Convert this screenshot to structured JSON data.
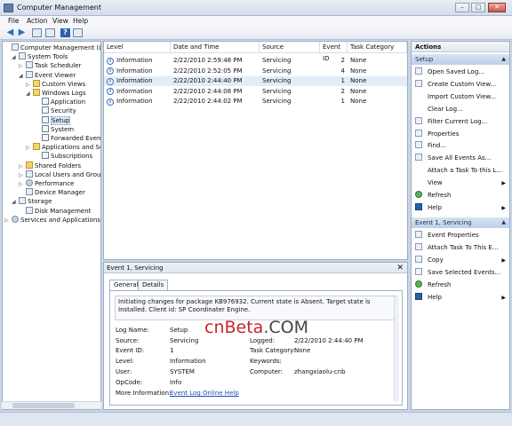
{
  "window": {
    "title": "Computer Management"
  },
  "menu": [
    "File",
    "Action",
    "View",
    "Help"
  ],
  "tree": [
    {
      "label": "Computer Management (Local",
      "icon": "computer-icon",
      "exp": ""
    },
    {
      "label": "System Tools",
      "icon": "tools-icon",
      "exp": "◢"
    },
    {
      "label": "Task Scheduler",
      "icon": "scheduler-icon",
      "exp": "▷"
    },
    {
      "label": "Event Viewer",
      "icon": "event-viewer-icon",
      "exp": "◢"
    },
    {
      "label": "Custom Views",
      "icon": "folder-icon",
      "exp": "▷"
    },
    {
      "label": "Windows Logs",
      "icon": "folder-icon",
      "exp": "◢"
    },
    {
      "label": "Application",
      "icon": "log-icon",
      "exp": ""
    },
    {
      "label": "Security",
      "icon": "log-icon",
      "exp": ""
    },
    {
      "label": "Setup",
      "icon": "log-icon",
      "exp": ""
    },
    {
      "label": "System",
      "icon": "log-icon",
      "exp": ""
    },
    {
      "label": "Forwarded Event",
      "icon": "log-icon",
      "exp": ""
    },
    {
      "label": "Applications and Se",
      "icon": "folder-icon",
      "exp": "▷"
    },
    {
      "label": "Subscriptions",
      "icon": "log-icon",
      "exp": ""
    },
    {
      "label": "Shared Folders",
      "icon": "folder-icon",
      "exp": "▷"
    },
    {
      "label": "Local Users and Groups",
      "icon": "users-icon",
      "exp": "▷"
    },
    {
      "label": "Performance",
      "icon": "performance-icon",
      "exp": "▷"
    },
    {
      "label": "Device Manager",
      "icon": "device-manager-icon",
      "exp": ""
    },
    {
      "label": "Storage",
      "icon": "storage-icon",
      "exp": "◢"
    },
    {
      "label": "Disk Management",
      "icon": "disk-icon",
      "exp": ""
    },
    {
      "label": "Services and Applications",
      "icon": "services-icon",
      "exp": "▷"
    }
  ],
  "events": {
    "columns": [
      "Level",
      "Date and Time",
      "Source",
      "Event ID",
      "Task Category"
    ],
    "rows": [
      {
        "level": "Information",
        "date": "2/22/2010 2:59:48 PM",
        "source": "Servicing",
        "id": "2",
        "category": "None"
      },
      {
        "level": "Information",
        "date": "2/22/2010 2:52:05 PM",
        "source": "Servicing",
        "id": "4",
        "category": "None"
      },
      {
        "level": "Information",
        "date": "2/22/2010 2:44:40 PM",
        "source": "Servicing",
        "id": "1",
        "category": "None"
      },
      {
        "level": "Information",
        "date": "2/22/2010 2:44:08 PM",
        "source": "Servicing",
        "id": "2",
        "category": "None"
      },
      {
        "level": "Information",
        "date": "2/22/2010 2:44:02 PM",
        "source": "Servicing",
        "id": "1",
        "category": "None"
      }
    ]
  },
  "detail": {
    "title": "Event 1, Servicing",
    "tabs": [
      "General",
      "Details"
    ],
    "description": "Initiating changes for package KB976932. Current state is Absent. Target state is Installed. Client id: SP Coordinater Engine.",
    "log_name_label": "Log Name:",
    "log_name": "Setup",
    "source_label": "Source:",
    "source": "Servicing",
    "logged_label": "Logged:",
    "logged": "2/22/2010 2:44:40 PM",
    "event_id_label": "Event ID:",
    "event_id": "1",
    "task_label": "Task Category:",
    "task": "None",
    "level_label": "Level:",
    "level": "Information",
    "keywords_label": "Keywords:",
    "user_label": "User:",
    "user": "SYSTEM",
    "computer_label": "Computer:",
    "computer": "zhangxiaolu-cnb",
    "opcode_label": "OpCode:",
    "opcode": "Info",
    "more_label": "More Information:",
    "more_link": "Event Log Online Help"
  },
  "watermark": {
    "cn": "cnBeta",
    "dot": ".COM"
  },
  "actions": {
    "header": "Actions",
    "section1": "Setup",
    "items1": [
      {
        "label": "Open Saved Log...",
        "icon": "open-log-icon"
      },
      {
        "label": "Create Custom View...",
        "icon": "filter-icon"
      },
      {
        "label": "Import Custom View...",
        "icon": "none"
      },
      {
        "label": "Clear Log...",
        "icon": "none"
      },
      {
        "label": "Filter Current Log...",
        "icon": "filter-icon"
      },
      {
        "label": "Properties",
        "icon": "properties-icon"
      },
      {
        "label": "Find...",
        "icon": "find-icon"
      },
      {
        "label": "Save All Events As...",
        "icon": "save-icon"
      },
      {
        "label": "Attach a Task To this L...",
        "icon": "none"
      },
      {
        "label": "View",
        "icon": "none",
        "sub": true
      },
      {
        "label": "Refresh",
        "icon": "refresh-icon"
      },
      {
        "label": "Help",
        "icon": "help-icon",
        "sub": true
      }
    ],
    "section2": "Event 1, Servicing",
    "items2": [
      {
        "label": "Event Properties",
        "icon": "properties-icon"
      },
      {
        "label": "Attach Task To This E...",
        "icon": "task-icon"
      },
      {
        "label": "Copy",
        "icon": "copy-icon",
        "sub": true
      },
      {
        "label": "Save Selected Events...",
        "icon": "save-icon"
      },
      {
        "label": "Refresh",
        "icon": "refresh-icon"
      },
      {
        "label": "Help",
        "icon": "help-icon",
        "sub": true
      }
    ]
  }
}
